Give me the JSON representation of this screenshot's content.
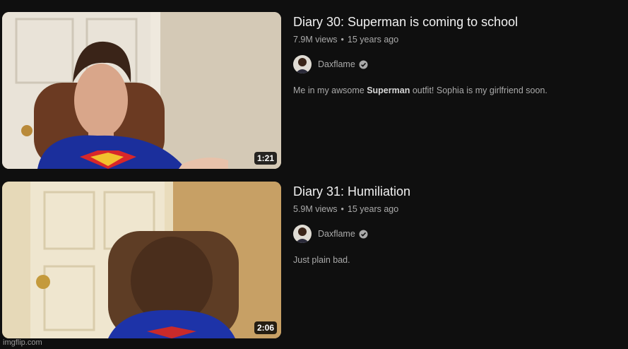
{
  "videos": [
    {
      "title": "Diary 30: Superman is coming to school",
      "views": "7.9M views",
      "age": "15 years ago",
      "channel": "Daxflame",
      "verified_icon": "verified-check-icon",
      "description_pre": "Me in my awsome ",
      "description_bold": "Superman",
      "description_post": " outfit! Sophia is my girlfriend soon.",
      "duration": "1:21"
    },
    {
      "title": "Diary 31: Humiliation",
      "views": "5.9M views",
      "age": "15 years ago",
      "channel": "Daxflame",
      "verified_icon": "verified-check-icon",
      "description": "Just plain bad.",
      "duration": "2:06"
    }
  ],
  "separator": "•",
  "watermark": "imgflip.com",
  "colors": {
    "background": "#0f0f0f",
    "title": "#f1f1f1",
    "secondary_text": "#aaaaaa"
  }
}
